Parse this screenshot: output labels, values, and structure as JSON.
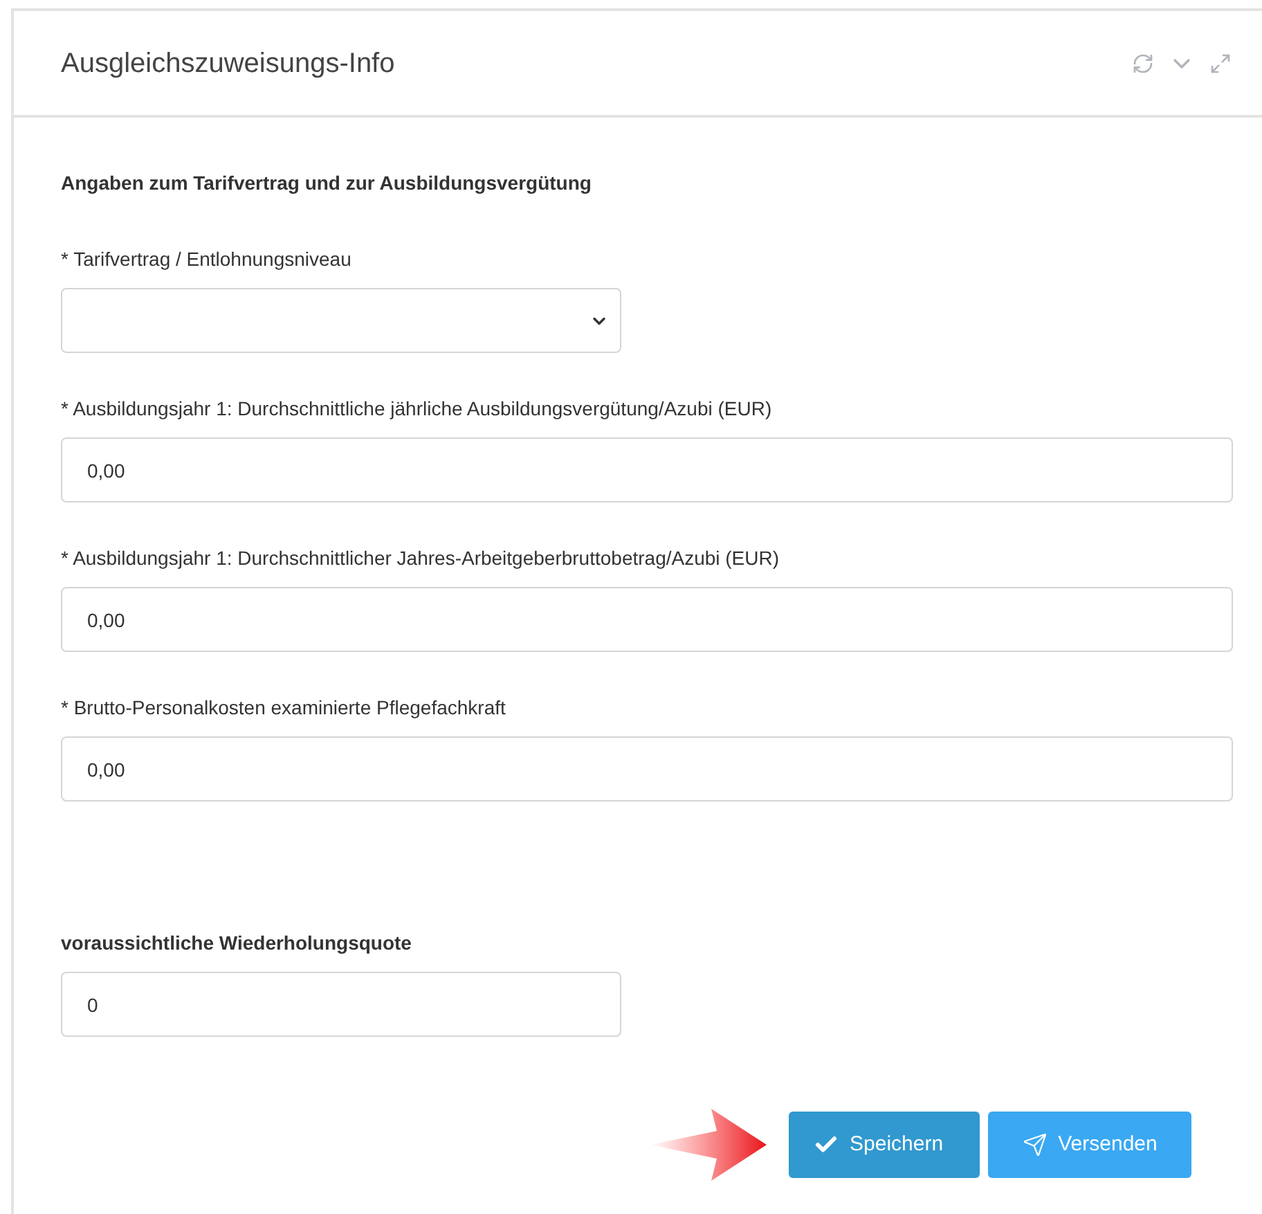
{
  "panel": {
    "title": "Ausgleichszuweisungs-Info"
  },
  "section_heading": "Angaben zum Tarifvertrag und zur Ausbildungsvergütung",
  "fields": [
    {
      "kind": "select",
      "label": "* Tarifvertrag / Entlohnungsniveau",
      "bold_label": false
    },
    {
      "kind": "input",
      "label": "* Ausbildungsjahr 1: Durchschnittliche jährliche Ausbildungsvergütung/Azubi (EUR)",
      "value": "0,00",
      "bold_label": false
    },
    {
      "kind": "input",
      "label": "* Ausbildungsjahr 1: Durchschnittlicher Jahres-Arbeitgeberbruttobetrag/Azubi (EUR)",
      "value": "0,00",
      "bold_label": false
    },
    {
      "kind": "input",
      "label": "* Brutto-Personalkosten examinierte Pflegefachkraft",
      "value": "0,00",
      "bold_label": false
    },
    {
      "kind": "short_input",
      "label": "voraussichtliche Wiederholungsquote",
      "value": "0",
      "bold_label": true
    }
  ],
  "buttons": [
    {
      "kind": "save",
      "label": "Speichern"
    },
    {
      "kind": "send",
      "label": "Versenden"
    }
  ]
}
